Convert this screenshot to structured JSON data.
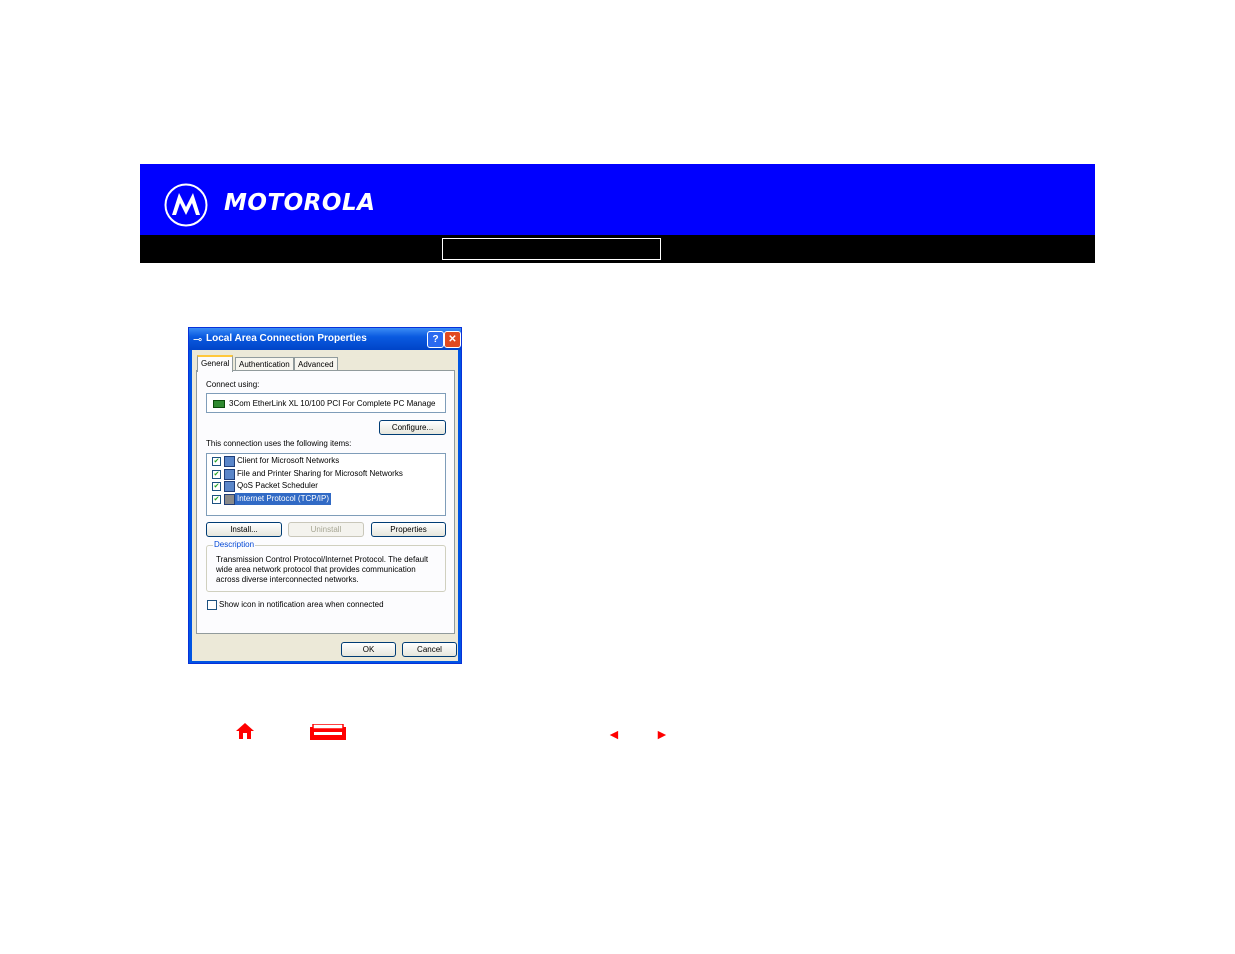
{
  "header": {
    "brand": "MOTOROLA",
    "logo_icon": "motorola-batwing-icon",
    "banner_color": "#0000ff"
  },
  "dialog": {
    "title": "Local Area Connection Properties",
    "help_label": "?",
    "close_label": "✕",
    "tabs": [
      {
        "label": "General"
      },
      {
        "label": "Authentication"
      },
      {
        "label": "Advanced"
      }
    ],
    "connect_using_label": "Connect using:",
    "adapter_name": "3Com EtherLink XL 10/100 PCI For Complete PC Manage",
    "configure_label": "Configure...",
    "items_label": "This connection uses the following items:",
    "items": [
      {
        "label": "Client for Microsoft Networks",
        "checked": true
      },
      {
        "label": "File and Printer Sharing for Microsoft Networks",
        "checked": true
      },
      {
        "label": "QoS Packet Scheduler",
        "checked": true
      },
      {
        "label": "Internet Protocol (TCP/IP)",
        "checked": true
      }
    ],
    "install_label": "Install...",
    "uninstall_label": "Uninstall",
    "properties_label": "Properties",
    "description_legend": "Description",
    "description_text": "Transmission Control Protocol/Internet Protocol. The default wide area network protocol that provides communication across diverse interconnected networks.",
    "notify_label": "Show icon in notification area when connected",
    "ok_label": "OK",
    "cancel_label": "Cancel"
  },
  "nav": {
    "home_icon": "home-icon",
    "print_icon": "print-icon",
    "prev_icon": "previous-arrow-icon",
    "next_icon": "next-arrow-icon",
    "accent_color": "#ff0000"
  }
}
